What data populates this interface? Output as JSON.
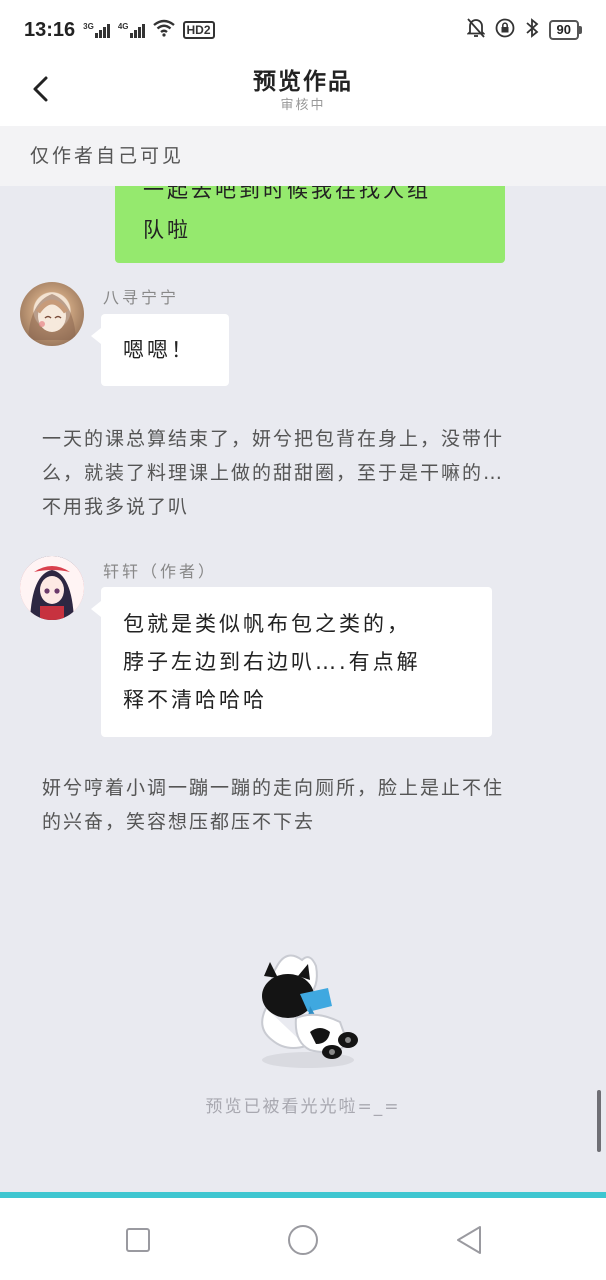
{
  "status_bar": {
    "time": "13:16",
    "signal_1": "3G",
    "signal_2": "4G",
    "hd": "HD2",
    "battery": "90"
  },
  "header": {
    "title": "预览作品",
    "subtitle": "审核中"
  },
  "notice": "仅作者自己可见",
  "messages": {
    "green_bubble_lines": [
      "一起去吧到时候我在找人组",
      "队啦"
    ],
    "msg1": {
      "sender": "八寻宁宁",
      "text": "嗯嗯！"
    },
    "narration_1": [
      "一天的课总算结束了，妍兮把包背在身上，没带什",
      "么，就装了料理课上做的甜甜圈，至于是干嘛的…",
      "不用我多说了叭"
    ],
    "msg2": {
      "sender": "轩轩（作者）",
      "lines": [
        "包就是类似帆布包之类的，",
        "脖子左边到右边叭….有点解",
        "释不清哈哈哈"
      ]
    },
    "narration_2": [
      "妍兮哼着小调一蹦一蹦的走向厕所，脸上是止不住",
      "的兴奋，笑容想压都压不下去"
    ]
  },
  "end_text": "预览已被看光光啦=_=",
  "colors": {
    "green_bubble": "#95e96e",
    "accent_line": "#3ec6d0",
    "background": "#e9eaf0"
  }
}
